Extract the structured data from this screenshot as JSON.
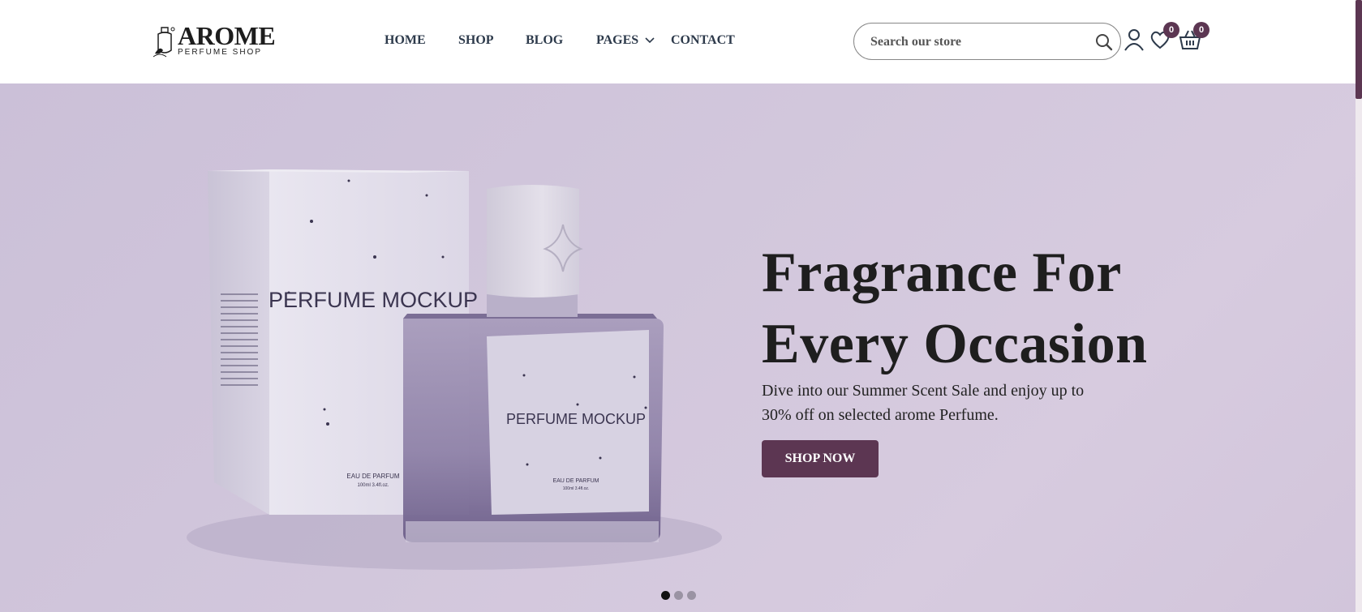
{
  "brand": {
    "title": "AROME",
    "subtitle": "PERFUME SHOP"
  },
  "nav": {
    "items": [
      {
        "label": "HOME"
      },
      {
        "label": "SHOP"
      },
      {
        "label": "BLOG"
      },
      {
        "label": "PAGES",
        "has_dropdown": true
      },
      {
        "label": "CONTACT"
      }
    ]
  },
  "search": {
    "placeholder": "Search our store",
    "icon": "search-icon"
  },
  "header_icons": {
    "account": {
      "icon": "user-icon"
    },
    "wishlist": {
      "icon": "heart-icon",
      "count": "0"
    },
    "cart": {
      "icon": "basket-icon",
      "count": "0"
    }
  },
  "hero": {
    "title_line1": "Fragrance For",
    "title_line2": "Every Occasion",
    "description": "Dive into our Summer Scent Sale and enjoy up to 30% off on selected arome Perfume.",
    "button_label": "SHOP NOW",
    "image": {
      "box_label": "PERFUME MOCKUP",
      "bottle_label": "PERFUME MOCKUP",
      "box_subtext": "EAU DE PARFUM",
      "box_volume": "100ml  3.4fl.oz.",
      "bottle_subtext": "EAU DE PARFUM",
      "bottle_volume": "100ml  3.4fl.oz."
    },
    "slides": {
      "count": 3,
      "active_index": 0
    }
  },
  "colors": {
    "accent": "#5c3652",
    "nav_text": "#2d3a4b",
    "hero_bg": "#d2c7dc"
  }
}
